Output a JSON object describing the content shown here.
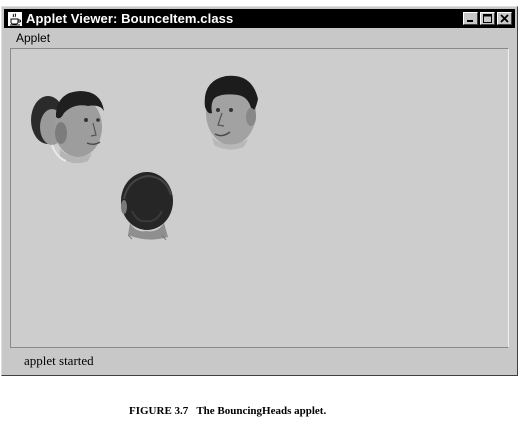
{
  "window": {
    "title": "Applet Viewer: BounceItem.class",
    "icon": "java-cup-icon",
    "controls": [
      "minimize-icon",
      "maximize-icon",
      "close-icon"
    ]
  },
  "menubar": {
    "items": [
      {
        "label": "Applet"
      }
    ]
  },
  "applet": {
    "heads": [
      {
        "view": "double-face-left"
      },
      {
        "view": "face-right"
      },
      {
        "view": "back-of-head"
      }
    ]
  },
  "status": {
    "text": "applet started"
  },
  "caption": {
    "text": "FIGURE 3.7   The BouncingHeads applet."
  },
  "colors": {
    "titlebar": "#000000",
    "window_bg": "#c8c8c8",
    "applet_bg": "#cdcdcd"
  }
}
